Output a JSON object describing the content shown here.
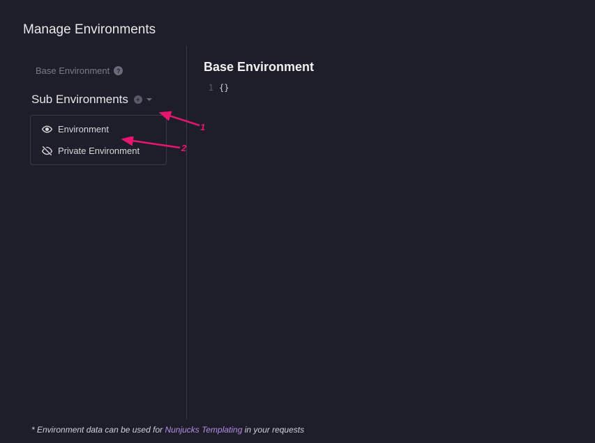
{
  "title": "Manage Environments",
  "sidebar": {
    "base_env_label": "Base Environment",
    "sub_env_title": "Sub Environments",
    "items": [
      {
        "label": "Environment"
      },
      {
        "label": "Private Environment"
      }
    ]
  },
  "main": {
    "title": "Base Environment",
    "editor": {
      "line_number": "1",
      "content": "{}"
    }
  },
  "footer": {
    "prefix": "* Environment data can be used for ",
    "link": "Nunjucks Templating",
    "suffix": " in your requests"
  },
  "annotations": {
    "one": "1",
    "two": "2"
  }
}
